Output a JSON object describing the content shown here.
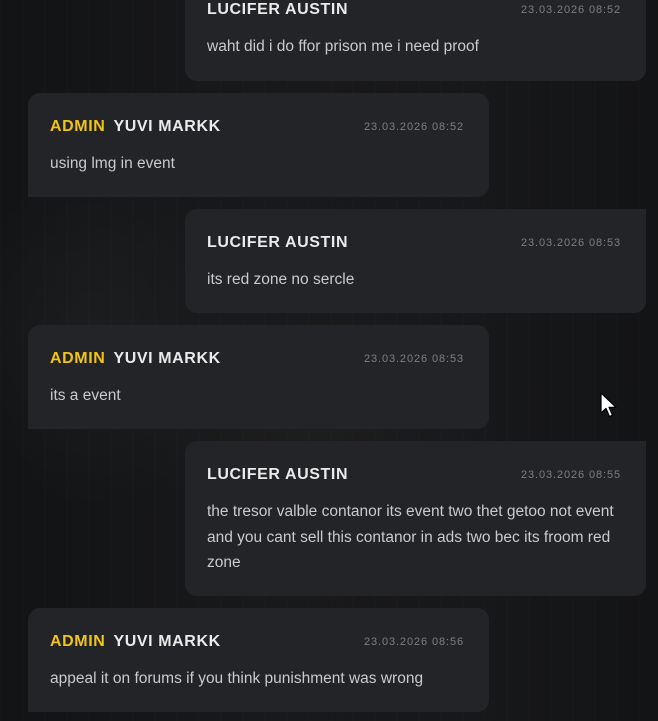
{
  "messages": [
    {
      "side": "right",
      "admin_tag": "",
      "author": "LUCIFER AUSTIN",
      "time": "23.03.2026 08:52",
      "text": "waht did i do ffor prison me i need proof"
    },
    {
      "side": "left",
      "admin_tag": "ADMIN",
      "author": "YUVI MARKK",
      "time": "23.03.2026 08:52",
      "text": "using lmg in event"
    },
    {
      "side": "right",
      "admin_tag": "",
      "author": "LUCIFER AUSTIN",
      "time": "23.03.2026 08:53",
      "text": "its red zone no sercle"
    },
    {
      "side": "left",
      "admin_tag": "ADMIN",
      "author": "YUVI MARKK",
      "time": "23.03.2026 08:53",
      "text": "its a event"
    },
    {
      "side": "right",
      "admin_tag": "",
      "author": "LUCIFER AUSTIN",
      "time": "23.03.2026 08:55",
      "text": "the tresor valble contanor its event two thet getoo not event and you cant sell this contanor in ads two bec its froom red zone"
    },
    {
      "side": "left",
      "admin_tag": "ADMIN",
      "author": "YUVI MARKK",
      "time": "23.03.2026 08:56",
      "text": "appeal it on forums if you think punishment was wrong"
    }
  ],
  "icons": {
    "cursor": "mouse-pointer-icon"
  }
}
